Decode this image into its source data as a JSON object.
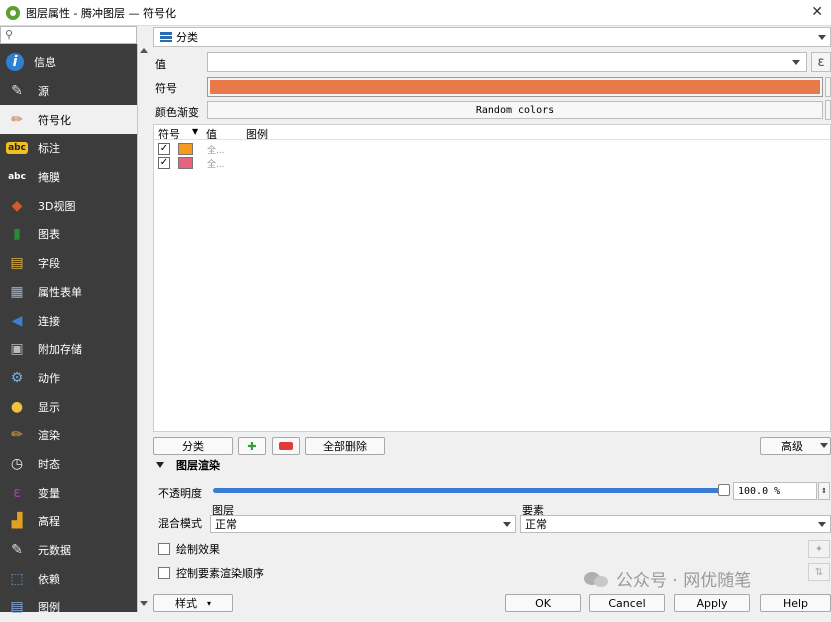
{
  "window": {
    "title": "图层属性 - 腾冲图层 — 符号化"
  },
  "sidebar": {
    "search_placeholder": "",
    "items": [
      {
        "label": "信息",
        "icon": "info-icon"
      },
      {
        "label": "源",
        "icon": "source-icon"
      },
      {
        "label": "符号化",
        "icon": "symbology-icon"
      },
      {
        "label": "标注",
        "icon": "labels-icon"
      },
      {
        "label": "掩膜",
        "icon": "mask-icon"
      },
      {
        "label": "3D视图",
        "icon": "3d-view-icon"
      },
      {
        "label": "图表",
        "icon": "diagram-icon"
      },
      {
        "label": "字段",
        "icon": "fields-icon"
      },
      {
        "label": "属性表单",
        "icon": "attributes-form-icon"
      },
      {
        "label": "连接",
        "icon": "joins-icon"
      },
      {
        "label": "附加存储",
        "icon": "auxiliary-storage-icon"
      },
      {
        "label": "动作",
        "icon": "actions-icon"
      },
      {
        "label": "显示",
        "icon": "display-icon"
      },
      {
        "label": "渲染",
        "icon": "rendering-icon"
      },
      {
        "label": "时态",
        "icon": "temporal-icon"
      },
      {
        "label": "变量",
        "icon": "variables-icon"
      },
      {
        "label": "高程",
        "icon": "elevation-icon"
      },
      {
        "label": "元数据",
        "icon": "metadata-icon"
      },
      {
        "label": "依赖",
        "icon": "dependencies-icon"
      },
      {
        "label": "图例",
        "icon": "legend-icon"
      }
    ],
    "active": "符号化"
  },
  "symbology": {
    "renderer": "分类",
    "value_label": "值",
    "value": "",
    "epsilon_button": "ε",
    "symbol_label": "符号",
    "symbol_color": "#e87a4a",
    "ramp_label": "颜色渐变",
    "ramp_value": "Random colors",
    "table_headers": {
      "symbol": "符号",
      "value": "值",
      "legend": "图例"
    },
    "classes": [
      {
        "checked": "✓",
        "color": "#f59a1c",
        "value": "全..."
      },
      {
        "checked": "✓",
        "color": "#e8637e",
        "value": "全..."
      }
    ],
    "classify_button": "分类",
    "delete_all_button": "全部删除",
    "advanced_button": "高级"
  },
  "layer_rendering": {
    "section_title": "图层渲染",
    "opacity_label": "不透明度",
    "opacity_value": "100.0 %",
    "opacity_fraction": 1.0,
    "blend_label": "混合模式",
    "layer_label": "图层",
    "layer_blend": "正常",
    "feature_label": "要素",
    "feature_blend": "正常",
    "draw_effects": "绘制效果",
    "control_order": "控制要素渲染顺序"
  },
  "footer": {
    "style_button": "样式",
    "ok": "OK",
    "cancel": "Cancel",
    "apply": "Apply",
    "help": "Help"
  },
  "watermark": "公众号 · 网优随笔"
}
